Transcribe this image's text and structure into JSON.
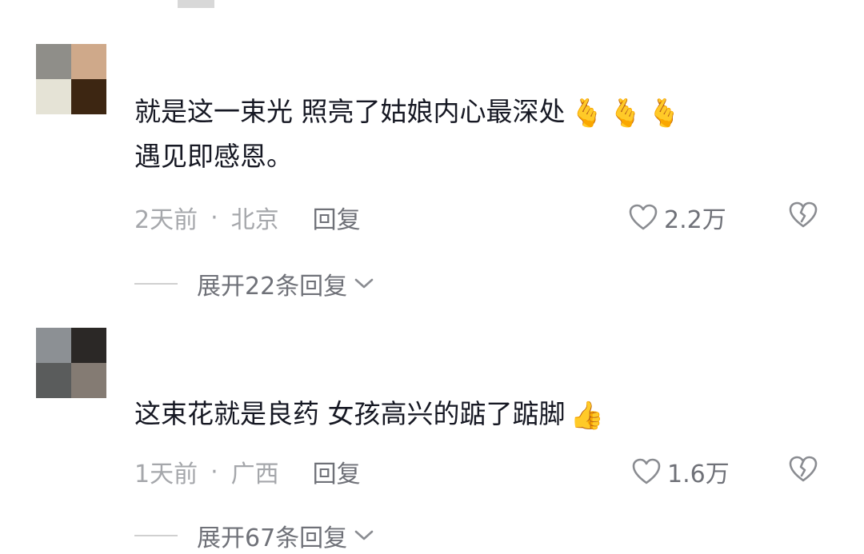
{
  "comments": [
    {
      "text_line1": "就是这一束光 照亮了姑娘内心最深处",
      "text_line2": "遇见即感恩。",
      "emojis": [
        "🫰",
        "🫰",
        "🫰"
      ],
      "time": "2天前",
      "separator": "·",
      "location": "北京",
      "reply_label": "回复",
      "likes": "2.2万",
      "expand_label": "展开22条回复",
      "avatar_colors": [
        "#8f8e89",
        "#cfa98a",
        "#e5e3d6",
        "#3d2612"
      ]
    },
    {
      "text_line1": "这束花就是良药 女孩高兴的踮了踮脚",
      "emojis": [
        "👍"
      ],
      "time": "1天前",
      "separator": "·",
      "location": "广西",
      "reply_label": "回复",
      "likes": "1.6万",
      "expand_label": "展开67条回复",
      "avatar_colors": [
        "#8c9094",
        "#2b2826",
        "#5a5c5c",
        "#847b73"
      ]
    }
  ],
  "icons": {
    "like": "heart-outline-icon",
    "dislike": "broken-heart-icon",
    "expand": "chevron-down-icon"
  }
}
